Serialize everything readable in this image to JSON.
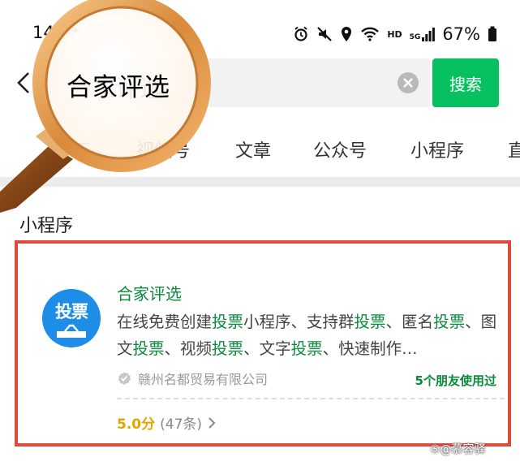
{
  "status_bar": {
    "time": "14",
    "plus": "+",
    "network_hd": "HD",
    "network_5g": "5G",
    "battery": "67%"
  },
  "search": {
    "query": "合家评选",
    "button_label": "搜索"
  },
  "magnifier": {
    "text": "合家评选"
  },
  "tabs": [
    {
      "label": "视频号"
    },
    {
      "label": "文章"
    },
    {
      "label": "公众号"
    },
    {
      "label": "小程序"
    },
    {
      "label": "直"
    }
  ],
  "section": {
    "title": "小程序"
  },
  "result": {
    "logo_text": "投票",
    "name": "合家评选",
    "description_parts": [
      {
        "text": "在线免费创建",
        "hl": false
      },
      {
        "text": "投票",
        "hl": true
      },
      {
        "text": "小程序、支持群",
        "hl": false
      },
      {
        "text": "投票",
        "hl": true
      },
      {
        "text": "、匿名",
        "hl": false
      },
      {
        "text": "投票",
        "hl": true
      },
      {
        "text": "、图文",
        "hl": false
      },
      {
        "text": "投票",
        "hl": true
      },
      {
        "text": "、视频",
        "hl": false
      },
      {
        "text": "投票",
        "hl": true
      },
      {
        "text": "、文字",
        "hl": false
      },
      {
        "text": "投票",
        "hl": true
      },
      {
        "text": "、快速制作…",
        "hl": false
      }
    ],
    "company": "赣州名都贸易有限公司",
    "friends_used": "5个朋友使用过",
    "score": "5.0分",
    "count": "(47条)"
  },
  "watermark": "⑤@慕容驿",
  "colors": {
    "brand_green": "#07c160",
    "highlight_green": "#0a8a3b",
    "frame_red": "#e24a3b",
    "logo_blue": "#1e8de8",
    "score_gold": "#e6a200"
  },
  "icons": [
    "back-arrow-icon",
    "clear-icon",
    "filter-icon",
    "alarm-icon",
    "mute-icon",
    "location-icon",
    "wifi-icon",
    "signal-icon",
    "battery-icon",
    "verified-icon",
    "chevron-right-icon",
    "magnifier-glass"
  ]
}
